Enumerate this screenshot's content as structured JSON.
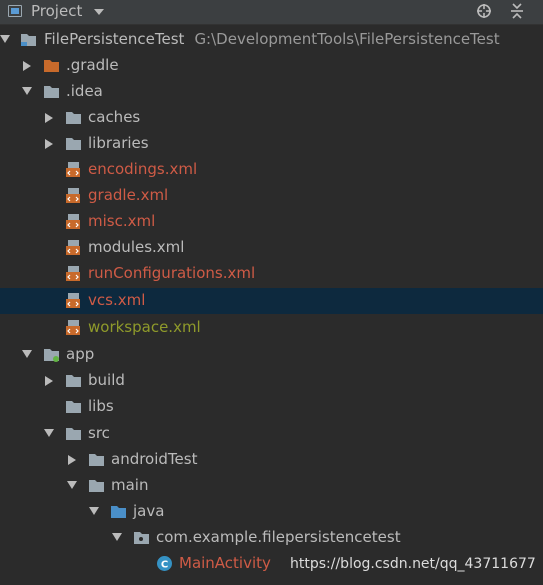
{
  "header": {
    "title": "Project",
    "locate_icon": "crosshair-icon",
    "collapse_icon": "collapse-all-icon"
  },
  "tree": {
    "root": {
      "label": "FilePersistenceTest",
      "path": "G:\\DevelopmentTools\\FilePersistenceTest"
    },
    "gradle": ".gradle",
    "idea": ".idea",
    "caches": "caches",
    "libraries": "libraries",
    "encodings": "encodings.xml",
    "gradle_xml": "gradle.xml",
    "misc": "misc.xml",
    "modules": "modules.xml",
    "run_configs": "runConfigurations.xml",
    "vcs": "vcs.xml",
    "workspace": "workspace.xml",
    "app": "app",
    "build": "build",
    "libs": "libs",
    "src": "src",
    "android_test": "androidTest",
    "main": "main",
    "java": "java",
    "package": "com.example.filepersistencetest",
    "main_activity": "MainActivity"
  },
  "watermark": "https://blog.csdn.net/qq_43711677",
  "colors": {
    "background": "#2b2b2b",
    "selected_row": "#0d293e",
    "modified_red": "#cf5b46",
    "unversioned_olive": "#8f9a2b"
  }
}
